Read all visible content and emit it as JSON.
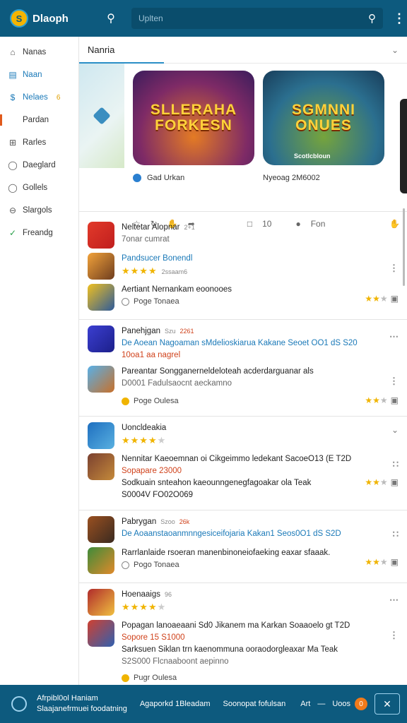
{
  "header": {
    "logo_text": "S",
    "title": "Dlaoph",
    "search_placeholder": "Uplten"
  },
  "sidebar": {
    "items": [
      {
        "label": "Nanas",
        "icon": "home-icon"
      },
      {
        "label": "Naan",
        "icon": "list-icon"
      },
      {
        "label": "Nelaes",
        "icon": "dollar-icon",
        "badge": "6"
      },
      {
        "label": "Pardan",
        "icon": "bar-icon"
      },
      {
        "label": "Rarles",
        "icon": "plus-square-icon"
      },
      {
        "label": "Daeglard",
        "icon": "chat-icon"
      },
      {
        "label": "Gollels",
        "icon": "chat-icon"
      },
      {
        "label": "Slargols",
        "icon": "circle-icon"
      },
      {
        "label": "Freandg",
        "icon": "check-icon"
      }
    ]
  },
  "featured": {
    "title": "Nanria",
    "cards": [
      {
        "title_line1": "SLLERAHA",
        "title_line2": "FORKESN",
        "sub": "",
        "author": "Gad Urkan"
      },
      {
        "title_line1": "SGMNNI",
        "title_line2": "ONUES",
        "sub": "Scotlcbloun",
        "author": "Nyeoag 2M6002"
      }
    ],
    "action_count_1": "10",
    "action_label_2": "Fon"
  },
  "groups": [
    {
      "rows": [
        {
          "title": "Neltetar Alopnar",
          "tag": "2+1",
          "line2": "7onar cumrat",
          "line2_class": "sub-gray",
          "right": ""
        },
        {
          "title": "Pandsucer Bonendl",
          "title_class": "sub-blue",
          "stars": 4,
          "line2": "2ssaam6",
          "line2_class": "sub-gray",
          "right": "kebab"
        },
        {
          "title": "Aertiant Nernankam eoonooes",
          "foot": "Poge Tonaea",
          "foot_dot": "gray",
          "right": "mini-stars"
        }
      ]
    },
    {
      "rows": [
        {
          "title": "Panehjgan",
          "tag": "Szu",
          "tag2": "2261",
          "line2": "De Aoean Nagoaman sMdelioskiarua Kakane Seoet OO1 dS S20",
          "line2_class": "sub-blue",
          "line3": "10oa1 aa nagrel",
          "line3_class": "sub-red",
          "right": "kebab-h"
        },
        {
          "title": "Pareantar Songganerneldeloteah acderdarguanar als",
          "line2": "D0001 Fadulsaocnt aeckamno",
          "line2_class": "sub-gray",
          "right": "kebab"
        },
        {
          "title": "",
          "foot": "Poge Oulesa",
          "foot_dot": "yellow",
          "right": "mini-stars"
        }
      ]
    },
    {
      "rows": [
        {
          "title": "Uoncldeakia",
          "stars": 4,
          "right": "chev"
        },
        {
          "title": "Nennitar Kaeoemnan oi Cikgeimmo ledekant SacoeO13 (E T2D",
          "line2": "Sopapare 23000",
          "line2_class": "sub-red",
          "line3": "Sodkuain snteahon kaeounngenegfagoakar ola Teak",
          "line3_class": "",
          "line4": "S0004V FO02O069",
          "line4_class": "",
          "right": "kebab"
        }
      ]
    },
    {
      "rows": [
        {
          "title": "Pabrygan",
          "tag": "Szoo",
          "tag2": "26k",
          "line2": "De Aoaanstaoanmnngesiceifojaria Kakan1 Seos0O1 dS S2D",
          "line2_class": "sub-blue",
          "line3": "",
          "right": "kebab"
        },
        {
          "title": "Rarrlanlaide rsoeran manenbinoneiofaeking eaxar sfaaak.",
          "foot": "Pogo Tonaea",
          "foot_dot": "gray",
          "right": "mini-stars"
        }
      ]
    },
    {
      "rows": [
        {
          "title": "Hoenaaigs",
          "tag": "96",
          "stars": 4,
          "right": "kebab-h"
        },
        {
          "title": "Popagan lanoaeaani Sd0 Jikanem ma Karkan Soaaoelo gt T2D",
          "line2": "Sopore 15 S1000",
          "line2_class": "sub-red",
          "line3": "Sarksuen Siklan trn kaenommuna ooraodorgleaxar Ma Teak",
          "line3_class": "",
          "line4": "S2S000 Flcnaaboont aepinno",
          "line4_class": "sub-gray",
          "right": "kebab"
        },
        {
          "title": "",
          "foot": "Pugr Oulesa",
          "foot_dot": "yellow",
          "right": ""
        }
      ]
    }
  ],
  "footer": {
    "line1": "Afrpibl0ol Haniam",
    "line1b": "Slaajanefrmuei foodatning",
    "link2": "Agaporkd 1Bleadam",
    "link3": "Soonopat fofulsan",
    "right_text": "Art",
    "right_text2": "Uoos",
    "badge": "0"
  },
  "colors": {
    "brand": "#0d5a7e",
    "accent": "#1a79b8",
    "star": "#f0b400",
    "alert": "#d0421b"
  }
}
